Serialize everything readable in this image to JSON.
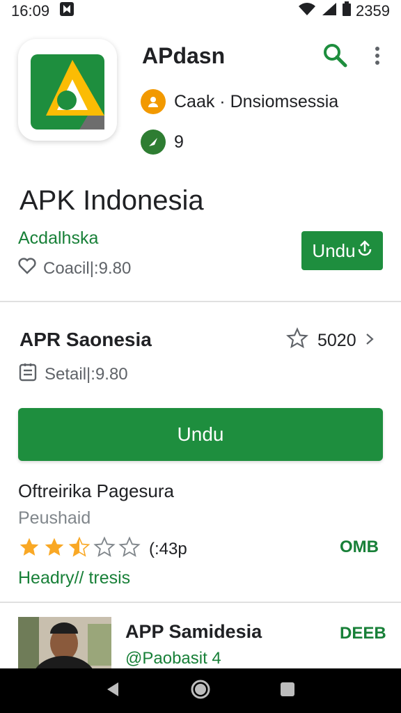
{
  "status": {
    "time": "16:09",
    "battery_text": "2359"
  },
  "app": {
    "name": "APdasn",
    "developer": "Caak · Dnsiomsessia",
    "rating_count": "9"
  },
  "listing": {
    "title": "APK  Indonesia",
    "subtitle": "Acdalhska",
    "meta": "Coacil|:9.80",
    "install_label": "Undu"
  },
  "card": {
    "title": "APR Saonesia",
    "rating_value": "5020",
    "meta": "Setail|:9.80",
    "install_label": "Undu"
  },
  "offer": {
    "title": "Oftreirika Pagesura",
    "subtitle": "Peushaid",
    "stars_filled": 2.5,
    "stars_total": 5,
    "stars_text": "(:43p",
    "size": "OMB",
    "link": "Headry// tresis"
  },
  "list_item": {
    "title": "APP Samidesia",
    "subtitle": "@Paobasit 4",
    "size": "DEEB"
  },
  "colors": {
    "accent_green": "#1e8e3e",
    "text_green": "#188038",
    "star_gold": "#f9a825"
  }
}
